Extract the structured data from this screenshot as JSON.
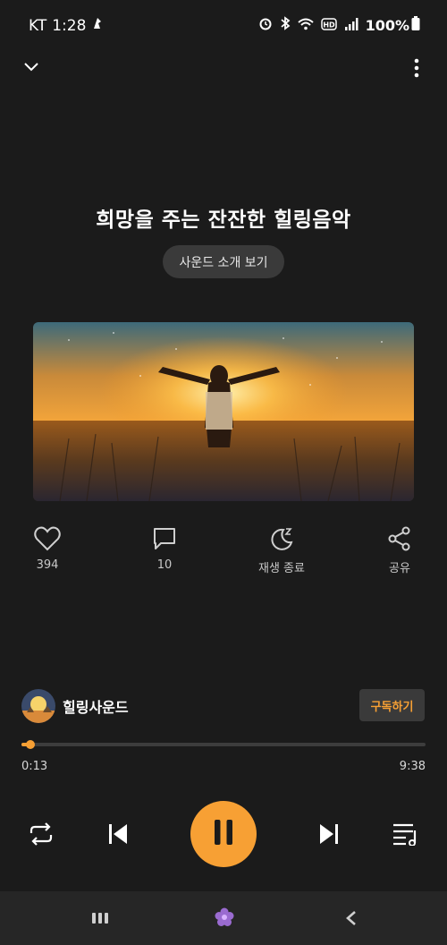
{
  "status_bar": {
    "carrier": "KT",
    "time": "1:28",
    "battery": "100%",
    "icons": [
      "notification-icon",
      "alarm-icon",
      "bluetooth-icon",
      "wifi-icon",
      "hd-icon",
      "signal-icon",
      "battery-icon"
    ]
  },
  "header": {
    "collapse_icon": "chevron-down-icon",
    "more_icon": "more-vertical-icon"
  },
  "track": {
    "title": "희망을 주는 잔잔한 힐링음악",
    "intro_button": "사운드 소개 보기"
  },
  "actions": {
    "like": {
      "icon": "heart-icon",
      "label": "394"
    },
    "comment": {
      "icon": "comment-icon",
      "label": "10"
    },
    "sleep_timer": {
      "icon": "moon-sleep-icon",
      "label": "재생 종료"
    },
    "share": {
      "icon": "share-icon",
      "label": "공유"
    }
  },
  "channel": {
    "name": "힐링사운드",
    "subscribe_label": "구독하기"
  },
  "playback": {
    "elapsed": "0:13",
    "duration": "9:38",
    "progress": 0.022
  },
  "controls": [
    "repeat-icon",
    "previous-icon",
    "pause-icon",
    "next-icon",
    "playlist-icon"
  ],
  "navbar": [
    "recent-apps-icon",
    "home-icon",
    "back-icon"
  ],
  "colors": {
    "accent": "#f7a034",
    "background": "#1b1b1b",
    "surface": "#3a3a3a"
  }
}
